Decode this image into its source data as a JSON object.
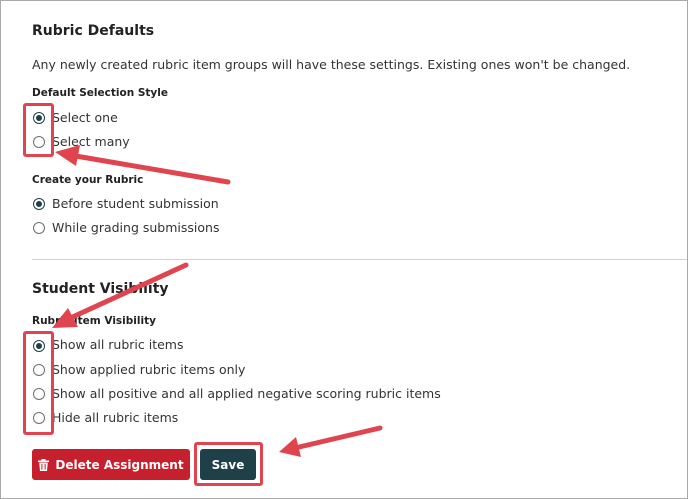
{
  "rubric_defaults": {
    "title": "Rubric Defaults",
    "description": "Any newly created rubric item groups will have these settings. Existing ones won't be changed.",
    "selection_style": {
      "label": "Default Selection Style",
      "options": [
        "Select one",
        "Select many"
      ],
      "selected_index": 0
    },
    "create_rubric": {
      "label": "Create your Rubric",
      "options": [
        "Before student submission",
        "While grading submissions"
      ],
      "selected_index": 0
    }
  },
  "student_visibility": {
    "title": "Student Visibility",
    "item_visibility": {
      "label": "Rubric Item Visibility",
      "options": [
        "Show all rubric items",
        "Show applied rubric items only",
        "Show all positive and all applied negative scoring rubric items",
        "Hide all rubric items"
      ],
      "selected_index": 0
    }
  },
  "actions": {
    "delete_label": "Delete Assignment",
    "save_label": "Save"
  },
  "colors": {
    "primary": "#1f4049",
    "danger": "#c6202e",
    "annotation": "#e0454f"
  },
  "icons": {
    "delete": "trash-icon"
  }
}
